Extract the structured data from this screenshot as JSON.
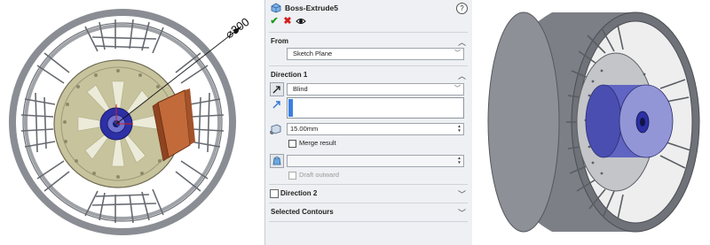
{
  "property_manager": {
    "title": "Boss-Extrude5",
    "help_icon_text": "?",
    "actions": {
      "ok": "✔",
      "cancel": "✖",
      "preview": "👁"
    },
    "from": {
      "label": "From",
      "selected": "Sketch Plane"
    },
    "direction1": {
      "label": "Direction 1",
      "end_condition": "Blind",
      "depth": "15.00mm",
      "merge_result_label": "Merge result",
      "merge_result_checked": false,
      "draft_outward_label": "Draft outward",
      "draft_outward_checked": false
    },
    "direction2": {
      "label": "Direction 2",
      "checked": false
    },
    "selected_contours": {
      "label": "Selected Contours"
    }
  },
  "left_viewport": {
    "dimension_text": "⌀300"
  },
  "colors": {
    "rim_gray": "#7c7f85",
    "hub_olive": "#c7c39c",
    "hub_dark": "#9e9a78",
    "bore_blue": "#2d2fa6",
    "face_lavender": "#9296d6",
    "extrude_orange": "#c26a3a",
    "pm_background": "#eef0f3",
    "accent_blue": "#3c7fe0",
    "ok_green": "#1c9a22",
    "cancel_red": "#d21f1f"
  }
}
